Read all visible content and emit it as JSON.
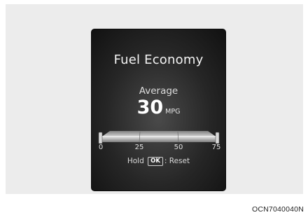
{
  "display": {
    "title": "Fuel Economy",
    "average_label": "Average",
    "value": "30",
    "unit": "MPG",
    "gauge": {
      "min": 0,
      "max": 75,
      "current": 0,
      "ticks": [
        "0",
        "25",
        "50",
        "75"
      ]
    },
    "hint": {
      "prefix": "Hold",
      "key": "OK",
      "suffix": ": Reset"
    }
  },
  "caption": "OCN7040040N"
}
